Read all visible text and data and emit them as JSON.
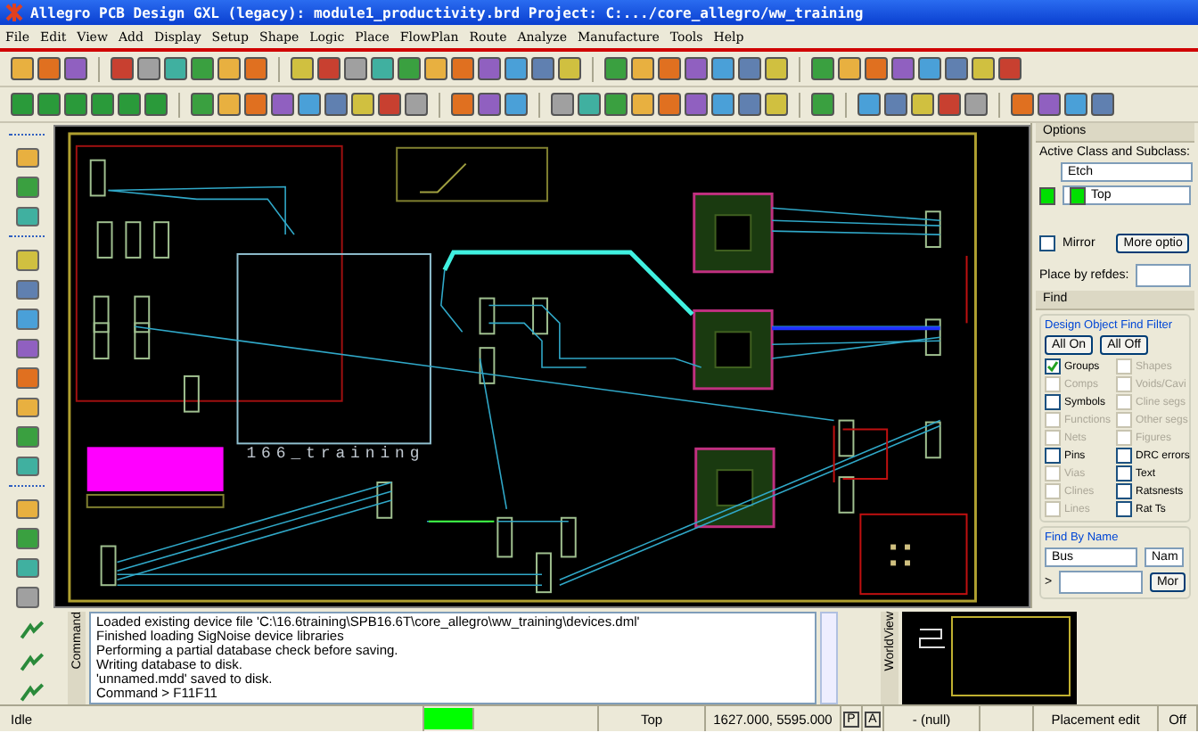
{
  "window": {
    "title": "Allegro PCB Design GXL (legacy): module1_productivity.brd  Project: C:.../core_allegro/ww_training"
  },
  "menu": [
    "File",
    "Edit",
    "View",
    "Add",
    "Display",
    "Setup",
    "Shape",
    "Logic",
    "Place",
    "FlowPlan",
    "Route",
    "Analyze",
    "Manufacture",
    "Tools",
    "Help"
  ],
  "canvas": {
    "board_label": "166_training"
  },
  "options_panel": {
    "title": "Options",
    "class_label": "Active Class and Subclass:",
    "class_value": "Etch",
    "subclass_value": "Top",
    "mirror": {
      "label": "Mirror",
      "checked": false
    },
    "more_button": "More optio",
    "refdes_label": "Place by refdes:"
  },
  "find_panel": {
    "title": "Find",
    "filter_title": "Design Object Find Filter",
    "all_on": "All On",
    "all_off": "All Off",
    "filters": [
      {
        "label": "Groups",
        "checked": true,
        "disabled": false
      },
      {
        "label": "Shapes",
        "checked": false,
        "disabled": true
      },
      {
        "label": "Comps",
        "checked": false,
        "disabled": true
      },
      {
        "label": "Voids/Cavi",
        "checked": false,
        "disabled": true
      },
      {
        "label": "Symbols",
        "checked": false,
        "disabled": false
      },
      {
        "label": "Cline segs",
        "checked": false,
        "disabled": true
      },
      {
        "label": "Functions",
        "checked": false,
        "disabled": true
      },
      {
        "label": "Other segs",
        "checked": false,
        "disabled": true
      },
      {
        "label": "Nets",
        "checked": false,
        "disabled": true
      },
      {
        "label": "Figures",
        "checked": false,
        "disabled": true
      },
      {
        "label": "Pins",
        "checked": false,
        "disabled": false
      },
      {
        "label": "DRC errors",
        "checked": false,
        "disabled": false
      },
      {
        "label": "Vias",
        "checked": false,
        "disabled": true
      },
      {
        "label": "Text",
        "checked": false,
        "disabled": false
      },
      {
        "label": "Clines",
        "checked": false,
        "disabled": true
      },
      {
        "label": "Ratsnests",
        "checked": false,
        "disabled": false
      },
      {
        "label": "Lines",
        "checked": false,
        "disabled": true
      },
      {
        "label": "Rat Ts",
        "checked": false,
        "disabled": false
      }
    ],
    "find_by_name_title": "Find By Name",
    "type_value": "Bus",
    "name_value": "Nam",
    "prompt": ">",
    "more_button": "Mor"
  },
  "command": {
    "tab_label": "Command",
    "lines": [
      "Loaded existing device file 'C:\\16.6training\\SPB16.6T\\core_allegro\\ww_training\\devices.dml'",
      "Finished loading SigNoise device libraries",
      "Performing a partial database check before saving.",
      "Writing database to disk.",
      "'unnamed.mdd' saved to disk.",
      "Command >   F11F11"
    ]
  },
  "worldview": {
    "tab_label": "WorldView"
  },
  "status_bar": [
    {
      "kind": "text",
      "text": "Idle"
    },
    {
      "kind": "indicator"
    },
    {
      "kind": "blank"
    },
    {
      "kind": "text",
      "text": "Top"
    },
    {
      "kind": "text",
      "text": "1627.000, 5595.000"
    },
    {
      "kind": "toggle",
      "text": "P"
    },
    {
      "kind": "toggle",
      "text": "A"
    },
    {
      "kind": "text",
      "text": "- (null)"
    },
    {
      "kind": "blank"
    },
    {
      "kind": "text",
      "text": "Placement edit"
    },
    {
      "kind": "text",
      "text": "Off"
    }
  ]
}
